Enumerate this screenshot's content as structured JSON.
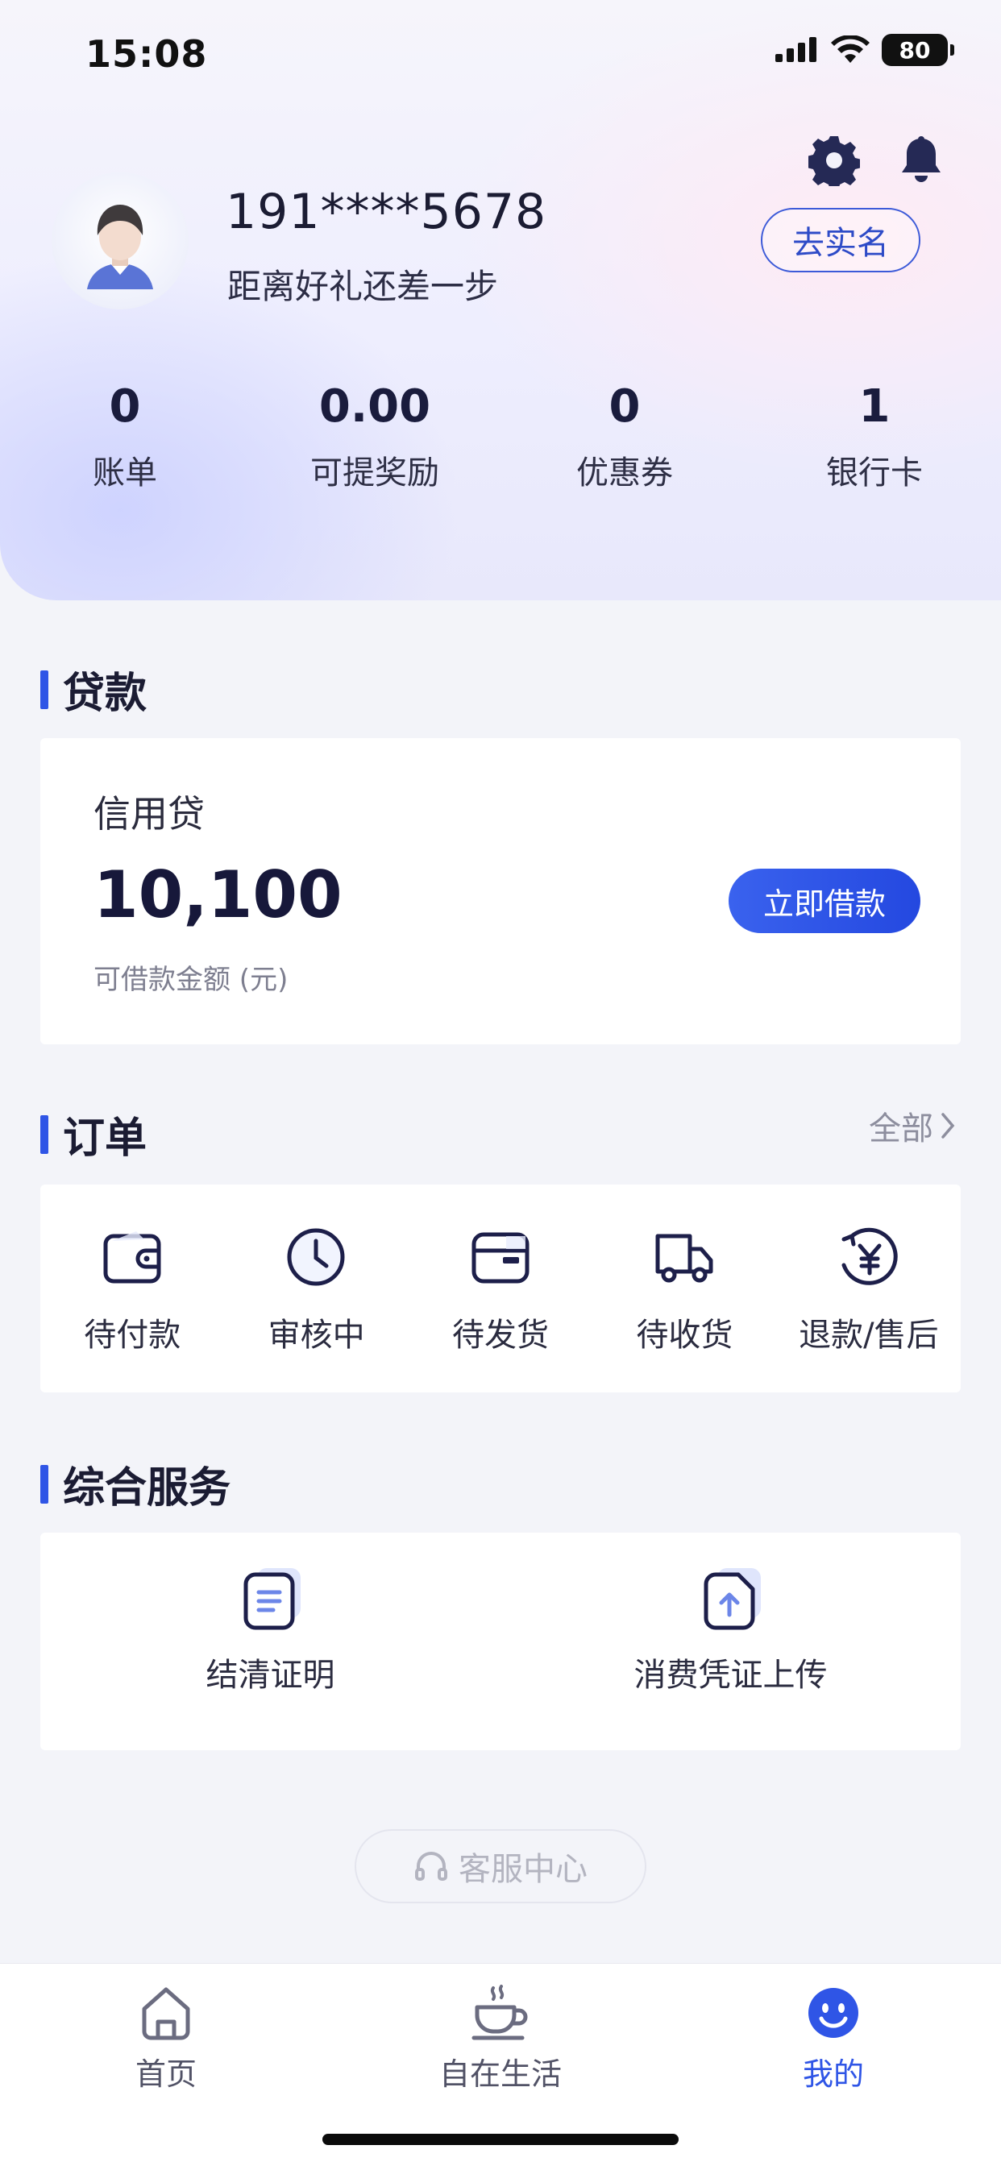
{
  "status_bar": {
    "time": "15:08",
    "battery": "80"
  },
  "profile": {
    "phone": "191****5678",
    "subtitle": "距离好礼还差一步",
    "verify_label": "去实名"
  },
  "stats": [
    {
      "value": "0",
      "label": "账单"
    },
    {
      "value": "0.00",
      "label": "可提奖励"
    },
    {
      "value": "0",
      "label": "优惠券"
    },
    {
      "value": "1",
      "label": "银行卡"
    }
  ],
  "loan": {
    "section_title": "贷款",
    "product": "信用贷",
    "amount": "10,100",
    "note": "可借款金额 (元)",
    "borrow_label": "立即借款"
  },
  "orders": {
    "section_title": "订单",
    "more_label": "全部",
    "items": [
      {
        "label": "待付款",
        "icon": "wallet-icon"
      },
      {
        "label": "审核中",
        "icon": "clock-icon"
      },
      {
        "label": "待发货",
        "icon": "package-icon"
      },
      {
        "label": "待收货",
        "icon": "truck-icon"
      },
      {
        "label": "退款/售后",
        "icon": "yen-refund-icon"
      }
    ]
  },
  "services": {
    "section_title": "综合服务",
    "items": [
      {
        "label": "结清证明",
        "icon": "document-icon"
      },
      {
        "label": "消费凭证上传",
        "icon": "upload-file-icon"
      }
    ]
  },
  "service_center_label": "客服中心",
  "tabbar": {
    "items": [
      {
        "label": "首页",
        "icon": "home-icon"
      },
      {
        "label": "自在生活",
        "icon": "coffee-cup-icon"
      },
      {
        "label": "我的",
        "icon": "smiley-icon",
        "active": true
      }
    ]
  },
  "colors": {
    "accent": "#2f55e6",
    "text": "#1b1c33"
  }
}
